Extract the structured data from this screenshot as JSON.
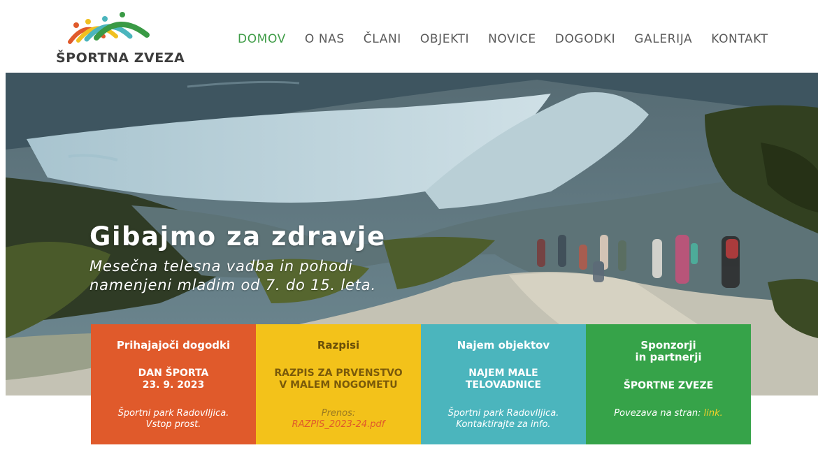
{
  "brand": {
    "name": "ŠPORTNA ZVEZA",
    "logo_icon": "people-arcs-logo-icon"
  },
  "nav": {
    "items": [
      {
        "label": "DOMOV",
        "active": true
      },
      {
        "label": "O NAS",
        "active": false
      },
      {
        "label": "ČLANI",
        "active": false
      },
      {
        "label": "OBJEKTI",
        "active": false
      },
      {
        "label": "NOVICE",
        "active": false
      },
      {
        "label": "DOGODKI",
        "active": false
      },
      {
        "label": "GALERIJA",
        "active": false
      },
      {
        "label": "KONTAKT",
        "active": false
      }
    ],
    "active_color": "#3f9c47"
  },
  "hero": {
    "title": "Gibajmo za zdravje",
    "subtitle_line1": "Mesečna telesna vadba in pohodi",
    "subtitle_line2": "namenjeni mladim od 7. do 15. leta."
  },
  "cards": [
    {
      "title": "Prihajajoči dogodki",
      "body_line1": "DAN ŠPORTA",
      "body_line2": "23. 9. 2023",
      "foot_line1": "Športni park Radovlljica.",
      "foot_line2": "Vstop prost.",
      "color": "#e05a2b"
    },
    {
      "title": "Razpisi",
      "body_line1": "RAZPIS ZA PRVENSTVO",
      "body_line2": "V MALEM NOGOMETU",
      "foot_line1": "Prenos:",
      "foot_link": "RAZPIS_2023-24.pdf",
      "color": "#f3c21a"
    },
    {
      "title": "Najem objektov",
      "body_line1": "NAJEM MALE",
      "body_line2": "TELOVADNICE",
      "foot_line1": "Športni park Radovlljica.",
      "foot_line2": "Kontaktirajte za info.",
      "color": "#4bb5bd"
    },
    {
      "title_line1": "Sponzorji",
      "title_line2": "in partnerji",
      "body_line1": "ŠPORTNE ZVEZE",
      "foot_text": "Povezava na stran: ",
      "foot_link": "link.",
      "color": "#36a349"
    }
  ]
}
